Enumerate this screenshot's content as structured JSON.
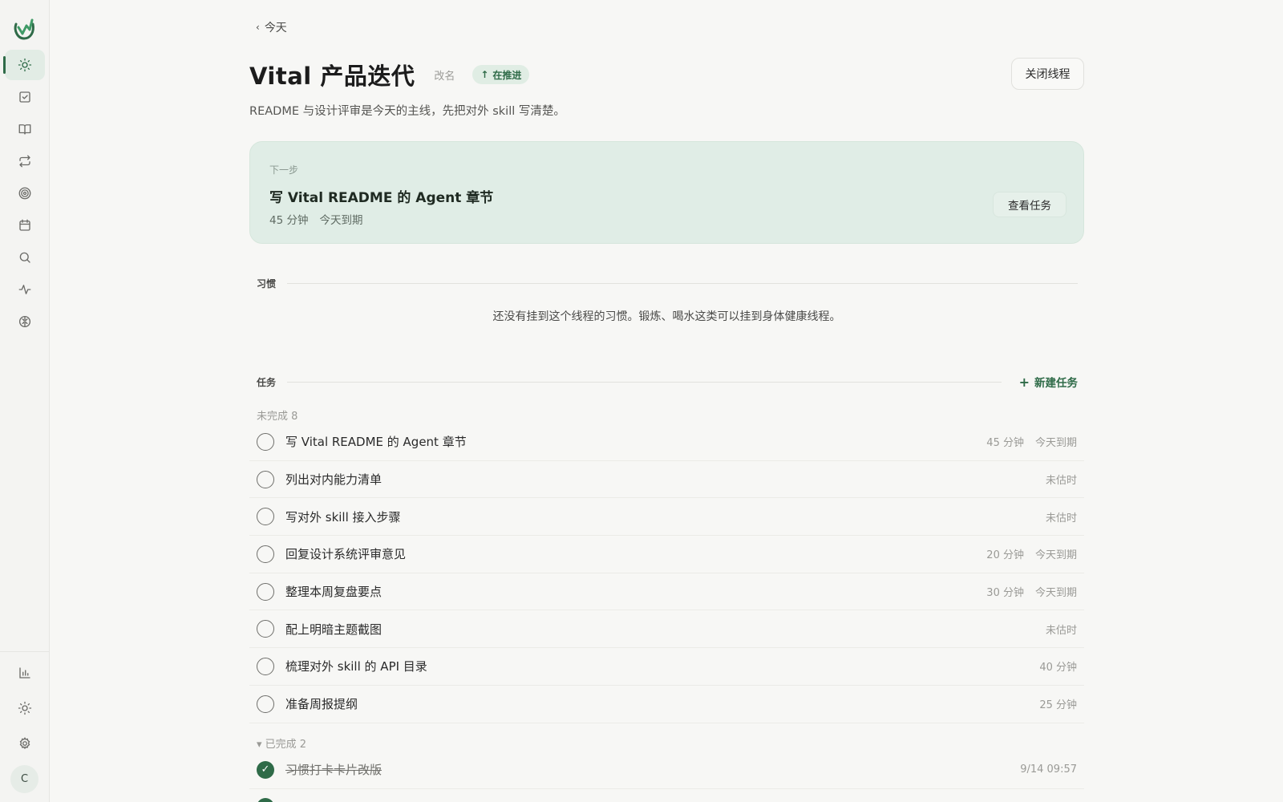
{
  "nav": {
    "back_label": "今天"
  },
  "thread": {
    "title": "Vital 产品迭代",
    "rename_label": "改名",
    "status_label": "在推进",
    "close_label": "关闭线程",
    "subtitle": "README 与设计评审是今天的主线，先把对外 skill 写清楚。"
  },
  "next_step": {
    "label": "下一步",
    "title": "写 Vital README 的 Agent 章节",
    "duration": "45 分钟",
    "due": "今天到期",
    "view_label": "查看任务"
  },
  "habits": {
    "label": "习惯",
    "empty_message": "还没有挂到这个线程的习惯。锻炼、喝水这类可以挂到身体健康线程。"
  },
  "tasks": {
    "label": "任务",
    "new_label": "新建任务",
    "open_group_label": "未完成 8",
    "open": [
      {
        "text": "写 Vital README 的 Agent 章节",
        "duration": "45 分钟",
        "due": "今天到期"
      },
      {
        "text": "列出对内能力清单",
        "duration": "未估时",
        "due": ""
      },
      {
        "text": "写对外 skill 接入步骤",
        "duration": "未估时",
        "due": ""
      },
      {
        "text": "回复设计系统评审意见",
        "duration": "20 分钟",
        "due": "今天到期"
      },
      {
        "text": "整理本周复盘要点",
        "duration": "30 分钟",
        "due": "今天到期"
      },
      {
        "text": "配上明暗主题截图",
        "duration": "未估时",
        "due": ""
      },
      {
        "text": "梳理对外 skill 的 API 目录",
        "duration": "40 分钟",
        "due": ""
      },
      {
        "text": "准备周报提纲",
        "duration": "25 分钟",
        "due": ""
      }
    ],
    "done_group_label": "▾ 已完成 2",
    "done": [
      {
        "text": "习惯打卡卡片改版",
        "completed_at": "9/14 09:57"
      }
    ]
  },
  "colors": {
    "accent": "#2f6b48",
    "card_bg": "#e0ede6",
    "page_bg": "#f7f7f5"
  }
}
